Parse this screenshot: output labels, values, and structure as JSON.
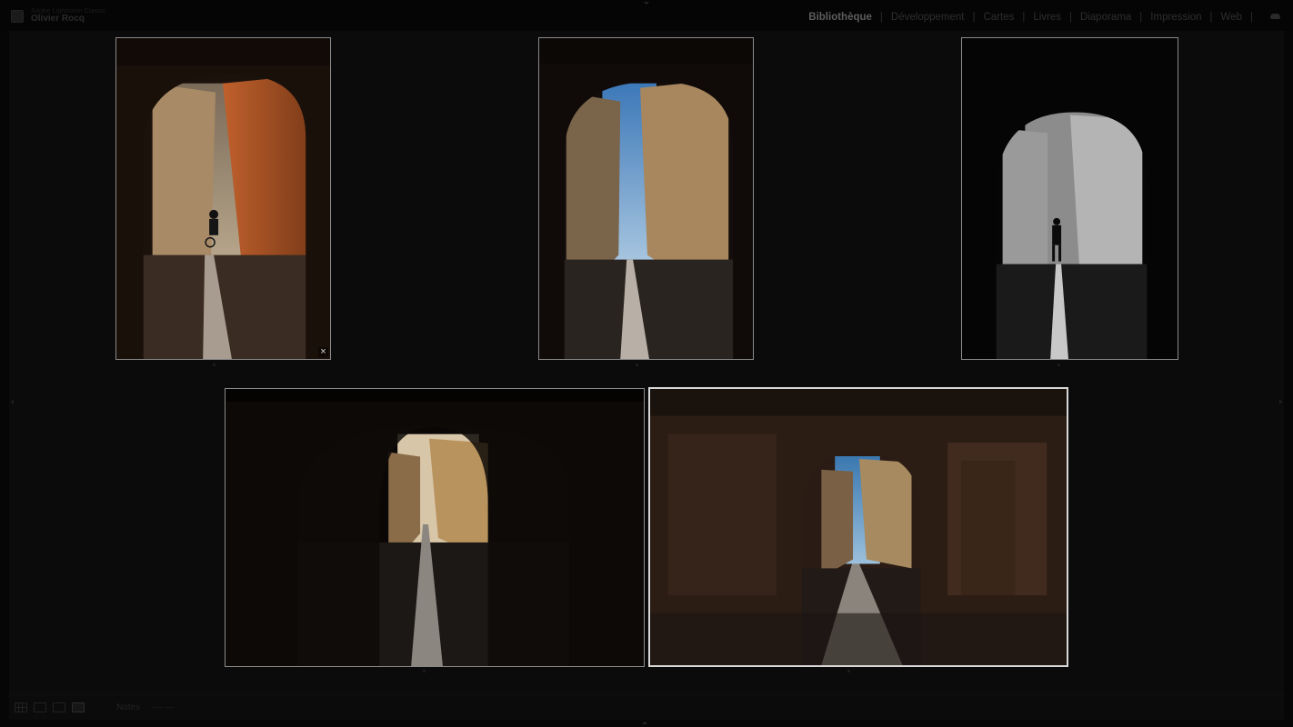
{
  "identity_plate": {
    "line1": "Adobe Lightroom Classic",
    "line2": "Olivier Rocq"
  },
  "modules": [
    {
      "label": "Bibliothèque",
      "active": true
    },
    {
      "label": "Développement",
      "active": false
    },
    {
      "label": "Cartes",
      "active": false
    },
    {
      "label": "Livres",
      "active": false
    },
    {
      "label": "Diaporama",
      "active": false
    },
    {
      "label": "Impression",
      "active": false
    },
    {
      "label": "Web",
      "active": false
    }
  ],
  "survey": {
    "photos": [
      {
        "name": "warm-alley-cyclist",
        "tone": "warm",
        "selected": false,
        "has_close": true
      },
      {
        "name": "alley-blue-sky",
        "tone": "natural",
        "selected": false,
        "has_close": false
      },
      {
        "name": "bw-alley-walker",
        "tone": "monochrome",
        "selected": false,
        "has_close": false
      },
      {
        "name": "dark-tunnel-landscape",
        "tone": "dark",
        "selected": false,
        "has_close": false
      },
      {
        "name": "tunnel-wide-landscape",
        "tone": "earthy",
        "selected": true,
        "has_close": true
      }
    ],
    "close_glyph": "×"
  },
  "toolbar": {
    "label": "Notes",
    "value": "— —"
  },
  "colors": {
    "background": "#060606",
    "panel": "#0b0b0b",
    "frame_border": "#8a8a8a",
    "selected_border": "#d8d8d8"
  }
}
